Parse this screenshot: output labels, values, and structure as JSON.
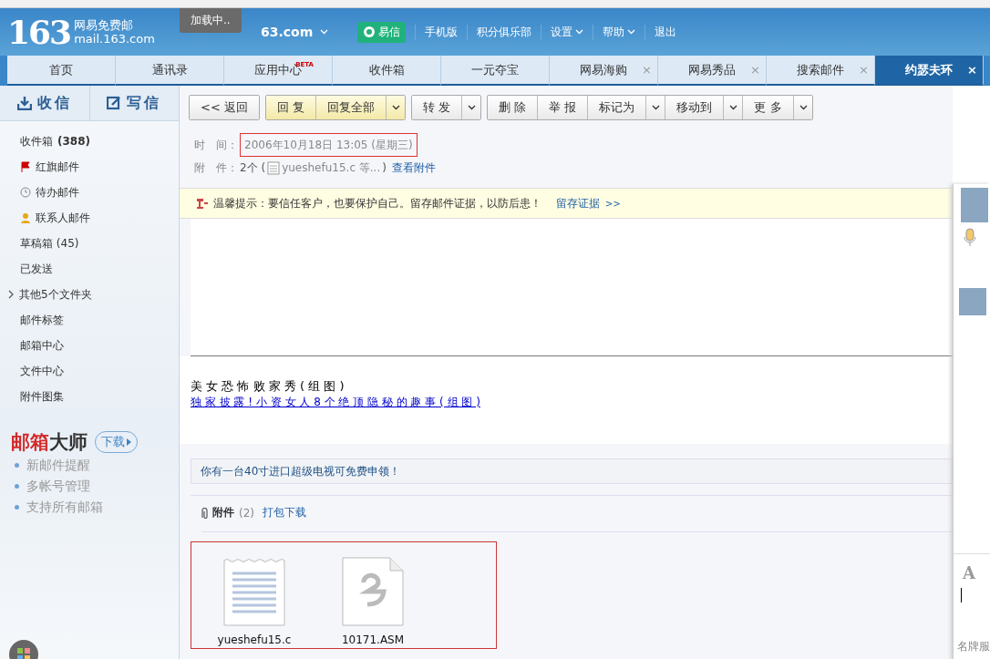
{
  "header": {
    "logo_number": "163",
    "logo_name": "网易免费邮",
    "logo_domain": "mail.163.com",
    "loading": "加载中..",
    "account": "63.com",
    "links": [
      {
        "label": "易信",
        "kind": "app",
        "dropdown": false
      },
      {
        "label": "手机版",
        "kind": "link",
        "dropdown": false
      },
      {
        "label": "积分俱乐部",
        "kind": "link",
        "dropdown": false
      },
      {
        "label": "设置",
        "kind": "link",
        "dropdown": true
      },
      {
        "label": "帮助",
        "kind": "link",
        "dropdown": true
      },
      {
        "label": "退出",
        "kind": "link",
        "dropdown": false
      }
    ]
  },
  "tabs": [
    {
      "label": "首页",
      "selected": false
    },
    {
      "label": "通讯录",
      "selected": false
    },
    {
      "label": "应用中心",
      "badge": "BETA",
      "selected": false
    },
    {
      "label": "收件箱",
      "selected": false
    },
    {
      "label": "一元夺宝",
      "selected": false
    },
    {
      "label": "网易海购",
      "selected": false,
      "close": "×"
    },
    {
      "label": "网易秀品",
      "selected": false,
      "close": "×"
    },
    {
      "label": "搜索邮件",
      "selected": false,
      "close": "×"
    },
    {
      "label": "约瑟夫环",
      "selected": true,
      "close": "×"
    }
  ],
  "sidebar": {
    "actions": [
      {
        "label": "收信",
        "kind": "receive"
      },
      {
        "label": "写信",
        "kind": "compose"
      }
    ],
    "items": [
      {
        "label": "收件箱",
        "count": "(388)",
        "kind": "plain"
      },
      {
        "label": "红旗邮件",
        "kind": "flag"
      },
      {
        "label": "待办邮件",
        "kind": "clock"
      },
      {
        "label": "联系人邮件",
        "kind": "person"
      },
      {
        "label": "草稿箱 (45)",
        "kind": "plain"
      },
      {
        "label": "已发送",
        "kind": "plain"
      },
      {
        "label": "其他5个文件夹",
        "kind": "expander"
      },
      {
        "label": "邮件标签",
        "kind": "plain"
      },
      {
        "label": "邮箱中心",
        "kind": "plain"
      },
      {
        "label": "文件中心",
        "kind": "plain"
      },
      {
        "label": "附件图集",
        "kind": "plain"
      }
    ],
    "promo": {
      "title_red": "邮箱",
      "title_dark": "大师",
      "download": "下载",
      "features": [
        "新邮件提醒",
        "多帐号管理",
        "支持所有邮箱"
      ]
    }
  },
  "toolbar": [
    [
      {
        "label": "<< 返回",
        "kind": "plain",
        "dropdown": false
      }
    ],
    [
      {
        "label": "回 复",
        "kind": "highlight",
        "dropdown": false
      },
      {
        "label": "回复全部",
        "kind": "highlight",
        "dropdown": true
      }
    ],
    [
      {
        "label": "转 发",
        "kind": "plain",
        "dropdown": true
      }
    ],
    [
      {
        "label": "删 除",
        "kind": "plain",
        "dropdown": false
      },
      {
        "label": "举 报",
        "kind": "plain",
        "dropdown": false
      },
      {
        "label": "标记为",
        "kind": "plain",
        "dropdown": true
      },
      {
        "label": "移动到",
        "kind": "plain",
        "dropdown": true
      },
      {
        "label": "更 多",
        "kind": "plain",
        "dropdown": true
      }
    ]
  ],
  "meta": {
    "time_label": "时　间：",
    "time": "2006年10月18日 13:05 (星期三)",
    "attach_label": "附　件：",
    "attach_count": "2个 (",
    "attach_names": "yueshefu15.c 等...",
    "attach_close": ")",
    "attach_link": "查看附件"
  },
  "tip": {
    "text": "温馨提示：要信任客户，也要保护自己。留存邮件证据，以防后患！",
    "link": "留存证据",
    "arrows": ">>"
  },
  "body": {
    "headline": "美 女 恐 怖 败 家 秀 ( 组 图 )",
    "link": "独 家 披 露 ! 小 资 女 人 8 个 绝 顶 隐 秘 的 趣 事 ( 组 图 )"
  },
  "ad": "你有一台40寸进口超级电视可免费申领！",
  "attachments": {
    "title": "附件",
    "count": "(2)",
    "download_all": "打包下载",
    "files": [
      {
        "name": "yueshefu15.c",
        "kind": "text"
      },
      {
        "name": "10171.ASM",
        "kind": "generic"
      }
    ]
  },
  "chat": {
    "footer": "名牌服",
    "format_glyph": "A"
  }
}
